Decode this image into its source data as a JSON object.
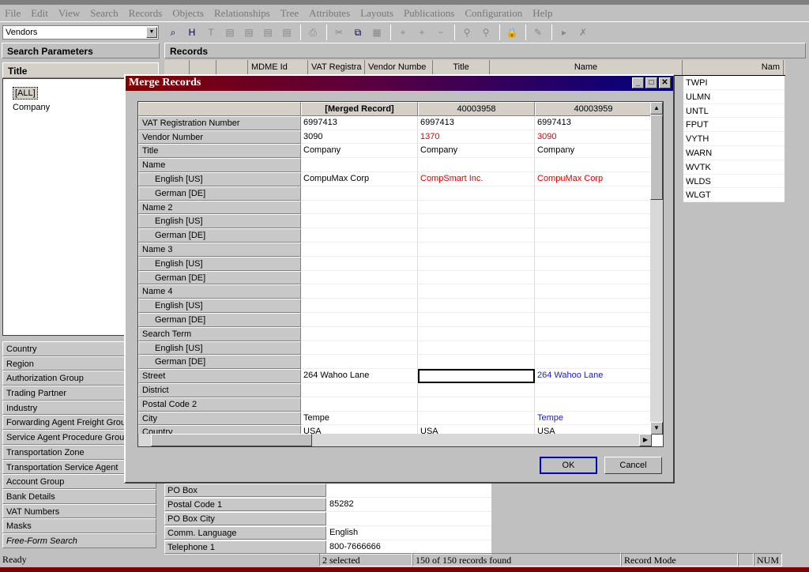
{
  "menu": [
    "File",
    "Edit",
    "View",
    "Search",
    "Records",
    "Objects",
    "Relationships",
    "Tree",
    "Attributes",
    "Layouts",
    "Publications",
    "Configuration",
    "Help"
  ],
  "table_selector": "Vendors",
  "toolbar_icons": [
    "search-records-icon",
    "hierarchy-icon",
    "text-sort-icon",
    "family-icon",
    "lookup-icon",
    "products-icon",
    "images-icon",
    "print-icon",
    "cut-icon",
    "copy-icon",
    "paste-icon",
    "add-row-icon",
    "insert-row-icon",
    "delete-row-icon",
    "find-icon",
    "find-next-icon",
    "lock-icon",
    "check-icon",
    "add-mark-icon",
    "remove-mark-icon"
  ],
  "search_params": {
    "header": "Search Parameters",
    "title_header": "Title",
    "title_values": [
      "[ALL]",
      "Company"
    ],
    "items": [
      "Country",
      "Region",
      "Authorization Group",
      "Trading Partner",
      "Industry",
      "Forwarding Agent Freight Grou",
      "Service Agent Procedure Grou",
      "Transportation Zone",
      "Transportation Service Agent",
      "Account Group",
      "Bank Details",
      "VAT Numbers",
      "Masks",
      "Free-Form Search"
    ]
  },
  "records": {
    "header": "Records",
    "columns": [
      "",
      "",
      "",
      "MDME Id",
      "VAT Registra",
      "Vendor Numbe",
      "Title",
      "Name",
      "Nam"
    ],
    "names": [
      "TWPI",
      "ULMN",
      "UNTL",
      "FPUT",
      "VYTH",
      "WARN",
      "WVTK",
      "WLDS",
      "WLGT"
    ]
  },
  "details": [
    {
      "k": "PO Box",
      "v": ""
    },
    {
      "k": "Postal Code 1",
      "v": "85282"
    },
    {
      "k": "PO Box City",
      "v": ""
    },
    {
      "k": "Comm. Language",
      "v": "English"
    },
    {
      "k": "Telephone 1",
      "v": "800-7666666"
    }
  ],
  "dialog": {
    "title": "Merge Records",
    "headers": [
      "[Merged Record]",
      "40003958",
      "40003959"
    ],
    "rows": [
      {
        "label": "VAT Registration Number",
        "sub": false,
        "vals": [
          "6997413",
          "6997413",
          "6997413"
        ],
        "cls": [
          "",
          "",
          ""
        ]
      },
      {
        "label": "Vendor Number",
        "sub": false,
        "vals": [
          "3090",
          "1370",
          "3090"
        ],
        "cls": [
          "",
          "red",
          "red"
        ]
      },
      {
        "label": "Title",
        "sub": false,
        "vals": [
          "Company",
          "Company",
          "Company"
        ],
        "cls": [
          "",
          "",
          ""
        ]
      },
      {
        "label": "Name",
        "sub": false,
        "vals": [
          "",
          "",
          ""
        ],
        "cls": [
          "",
          "",
          ""
        ]
      },
      {
        "label": "English [US]",
        "sub": true,
        "vals": [
          "CompuMax Corp",
          "CompSmart Inc.",
          "CompuMax Corp"
        ],
        "cls": [
          "",
          "red",
          "red"
        ]
      },
      {
        "label": "German [DE]",
        "sub": true,
        "vals": [
          "",
          "",
          ""
        ],
        "cls": [
          "",
          "",
          ""
        ]
      },
      {
        "label": "Name 2",
        "sub": false,
        "vals": [
          "",
          "",
          ""
        ],
        "cls": [
          "",
          "",
          ""
        ]
      },
      {
        "label": "English [US]",
        "sub": true,
        "vals": [
          "",
          "",
          ""
        ],
        "cls": [
          "",
          "",
          ""
        ]
      },
      {
        "label": "German [DE]",
        "sub": true,
        "vals": [
          "",
          "",
          ""
        ],
        "cls": [
          "",
          "",
          ""
        ]
      },
      {
        "label": "Name 3",
        "sub": false,
        "vals": [
          "",
          "",
          ""
        ],
        "cls": [
          "",
          "",
          ""
        ]
      },
      {
        "label": "English [US]",
        "sub": true,
        "vals": [
          "",
          "",
          ""
        ],
        "cls": [
          "",
          "",
          ""
        ]
      },
      {
        "label": "German [DE]",
        "sub": true,
        "vals": [
          "",
          "",
          ""
        ],
        "cls": [
          "",
          "",
          ""
        ]
      },
      {
        "label": "Name 4",
        "sub": false,
        "vals": [
          "",
          "",
          ""
        ],
        "cls": [
          "",
          "",
          ""
        ]
      },
      {
        "label": "English [US]",
        "sub": true,
        "vals": [
          "",
          "",
          ""
        ],
        "cls": [
          "",
          "",
          ""
        ]
      },
      {
        "label": "German [DE]",
        "sub": true,
        "vals": [
          "",
          "",
          ""
        ],
        "cls": [
          "",
          "",
          ""
        ]
      },
      {
        "label": "Search Term",
        "sub": false,
        "vals": [
          "",
          "",
          ""
        ],
        "cls": [
          "",
          "",
          ""
        ]
      },
      {
        "label": "English [US]",
        "sub": true,
        "vals": [
          "",
          "",
          ""
        ],
        "cls": [
          "",
          "",
          ""
        ]
      },
      {
        "label": "German [DE]",
        "sub": true,
        "vals": [
          "",
          "",
          ""
        ],
        "cls": [
          "",
          "",
          ""
        ]
      },
      {
        "label": "Street",
        "sub": false,
        "vals": [
          "264 Wahoo Lane",
          "",
          "264 Wahoo Lane"
        ],
        "cls": [
          "",
          "focus",
          "blue"
        ]
      },
      {
        "label": "District",
        "sub": false,
        "vals": [
          "",
          "",
          ""
        ],
        "cls": [
          "",
          "",
          ""
        ]
      },
      {
        "label": "Postal Code 2",
        "sub": false,
        "vals": [
          "",
          "",
          ""
        ],
        "cls": [
          "",
          "",
          ""
        ]
      },
      {
        "label": "City",
        "sub": false,
        "vals": [
          "Tempe",
          "",
          "Tempe"
        ],
        "cls": [
          "",
          "",
          "blue"
        ]
      },
      {
        "label": "Country",
        "sub": false,
        "vals": [
          "USA",
          "USA",
          "USA"
        ],
        "cls": [
          "",
          "",
          ""
        ]
      }
    ],
    "ok": "OK",
    "cancel": "Cancel"
  },
  "status": {
    "ready": "Ready",
    "selected": "2 selected",
    "found": "150 of 150 records found",
    "mode": "Record Mode",
    "num": "NUM"
  }
}
